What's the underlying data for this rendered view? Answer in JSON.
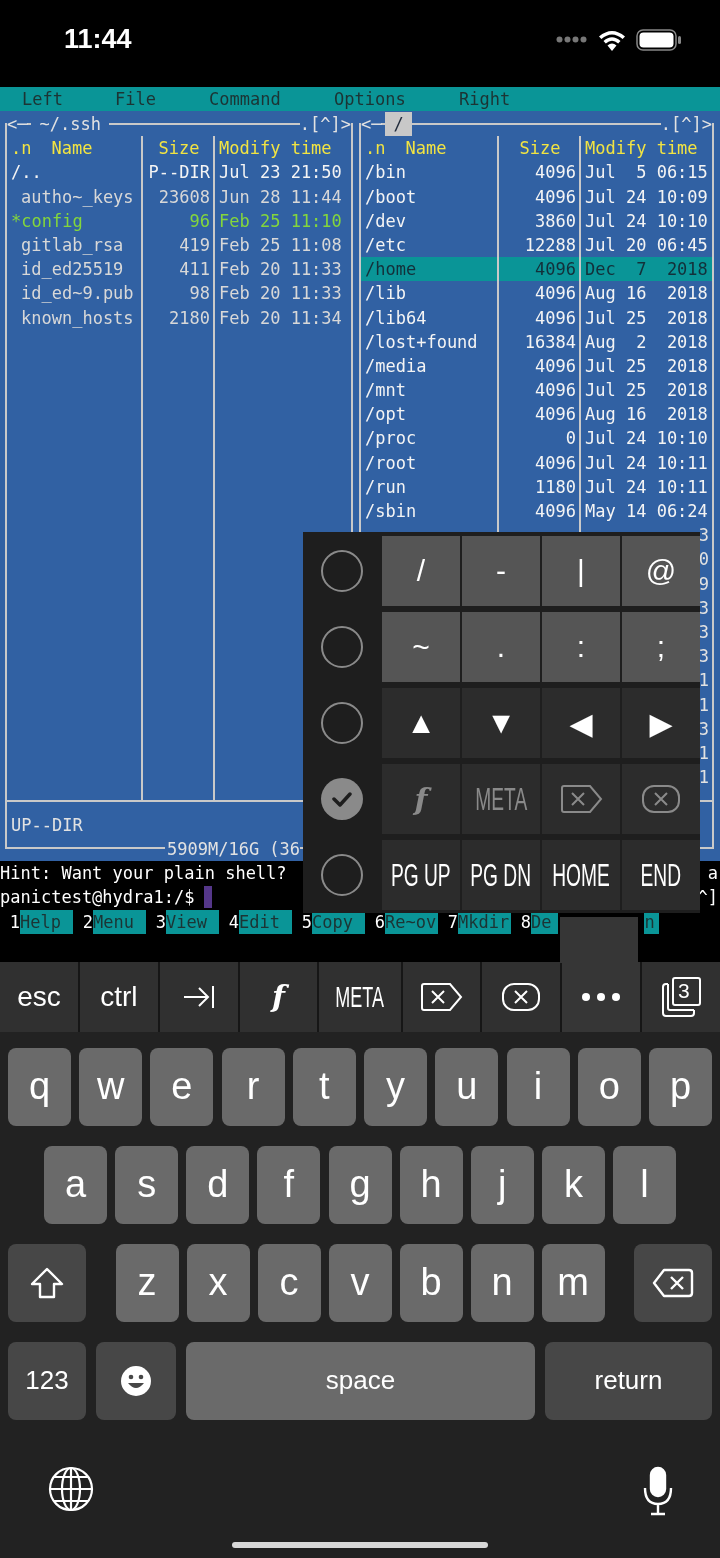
{
  "status_bar": {
    "time": "11:44"
  },
  "menu_bar": {
    "items": [
      "Left",
      "File",
      "Command",
      "Options",
      "Right"
    ]
  },
  "left_panel": {
    "title": {
      "prefix": "<─",
      "path": "~/.ssh",
      "active": false
    },
    "title_suffix": ".[^]>",
    "sort_mark": ".n",
    "columns": [
      "Name",
      "Size",
      "Modify time"
    ],
    "rows": [
      {
        "name": "/..",
        "size": "P--DIR",
        "time": "Jul 23 21:50",
        "kind": "dir",
        "selected": false
      },
      {
        "name": "autho~_keys",
        "size": "23608",
        "time": "Jun 28 11:44",
        "kind": "file",
        "selected": false
      },
      {
        "name": "*config",
        "size": "96",
        "time": "Feb 25 11:10",
        "kind": "executable",
        "selected": false
      },
      {
        "name": "gitlab_rsa",
        "size": "419",
        "time": "Feb 25 11:08",
        "kind": "file",
        "selected": false
      },
      {
        "name": "id_ed25519",
        "size": "411",
        "time": "Feb 20 11:33",
        "kind": "file",
        "selected": false
      },
      {
        "name": "id_ed~9.pub",
        "size": "98",
        "time": "Feb 20 11:33",
        "kind": "file",
        "selected": false
      },
      {
        "name": "known_hosts",
        "size": "2180",
        "time": "Feb 20 11:34",
        "kind": "file",
        "selected": false
      }
    ],
    "mini_status": "UP--DIR",
    "disk_info": "5909M/16G (36"
  },
  "right_panel": {
    "title": {
      "prefix": "<─",
      "path": "/",
      "active": true
    },
    "title_suffix": ".[^]>",
    "sort_mark": ".n",
    "columns": [
      "Name",
      "Size",
      "Modify time"
    ],
    "rows": [
      {
        "name": "/bin",
        "size": "4096",
        "time": "Jul  5 06:15",
        "kind": "dir",
        "selected": false
      },
      {
        "name": "/boot",
        "size": "4096",
        "time": "Jul 24 10:09",
        "kind": "dir",
        "selected": false
      },
      {
        "name": "/dev",
        "size": "3860",
        "time": "Jul 24 10:10",
        "kind": "dir",
        "selected": false
      },
      {
        "name": "/etc",
        "size": "12288",
        "time": "Jul 20 06:45",
        "kind": "dir",
        "selected": false
      },
      {
        "name": "/home",
        "size": "4096",
        "time": "Dec  7  2018",
        "kind": "dir",
        "selected": true
      },
      {
        "name": "/lib",
        "size": "4096",
        "time": "Aug 16  2018",
        "kind": "dir",
        "selected": false
      },
      {
        "name": "/lib64",
        "size": "4096",
        "time": "Jul 25  2018",
        "kind": "dir",
        "selected": false
      },
      {
        "name": "/lost+found",
        "size": "16384",
        "time": "Aug  2  2018",
        "kind": "dir",
        "selected": false
      },
      {
        "name": "/media",
        "size": "4096",
        "time": "Jul 25  2018",
        "kind": "dir",
        "selected": false
      },
      {
        "name": "/mnt",
        "size": "4096",
        "time": "Jul 25  2018",
        "kind": "dir",
        "selected": false
      },
      {
        "name": "/opt",
        "size": "4096",
        "time": "Aug 16  2018",
        "kind": "dir",
        "selected": false
      },
      {
        "name": "/proc",
        "size": "0",
        "time": "Jul 24 10:10",
        "kind": "dir",
        "selected": false
      },
      {
        "name": "/root",
        "size": "4096",
        "time": "Jul 24 10:11",
        "kind": "dir",
        "selected": false
      },
      {
        "name": "/run",
        "size": "1180",
        "time": "Jul 24 10:11",
        "kind": "dir",
        "selected": false
      },
      {
        "name": "/sbin",
        "size": "4096",
        "time": "May 14 06:24",
        "kind": "dir",
        "selected": false
      }
    ],
    "hidden_row_tails": [
      "3",
      "0",
      "9",
      "3",
      "3",
      "3",
      "1",
      "1",
      "3",
      "1",
      "1"
    ]
  },
  "hint": "Hint: Want your plain shell?",
  "hint_tail": "a",
  "prompt": "panictest@hydra1:/$",
  "prompt_tail": "^]",
  "function_keys": [
    {
      "number": "1",
      "label": "Help"
    },
    {
      "number": "2",
      "label": "Menu"
    },
    {
      "number": "3",
      "label": "View"
    },
    {
      "number": "4",
      "label": "Edit"
    },
    {
      "number": "5",
      "label": "Copy"
    },
    {
      "number": "6",
      "label": "Re~ov"
    },
    {
      "number": "7",
      "label": "Mkdir"
    },
    {
      "number": "8",
      "label": "De"
    }
  ],
  "function_key_tail": "n",
  "extra_keys_panel": {
    "rows": [
      {
        "selected": false,
        "kind": "symbols",
        "keys": [
          {
            "kind": "text",
            "label": "/"
          },
          {
            "kind": "text",
            "label": "-"
          },
          {
            "kind": "text",
            "label": "|"
          },
          {
            "kind": "text",
            "label": "@"
          }
        ]
      },
      {
        "selected": false,
        "kind": "symbols",
        "keys": [
          {
            "kind": "text",
            "label": "~"
          },
          {
            "kind": "text",
            "label": "."
          },
          {
            "kind": "text",
            "label": ":"
          },
          {
            "kind": "text",
            "label": ";"
          }
        ]
      },
      {
        "selected": false,
        "kind": "special",
        "keys": [
          {
            "kind": "text",
            "label": "▲"
          },
          {
            "kind": "text",
            "label": "▼"
          },
          {
            "kind": "text",
            "label": "◀"
          },
          {
            "kind": "text",
            "label": "▶"
          }
        ]
      },
      {
        "selected": true,
        "kind": "special",
        "keys": [
          {
            "kind": "function",
            "label": "f"
          },
          {
            "kind": "condensed",
            "label": "META"
          },
          {
            "kind": "forward-delete"
          },
          {
            "kind": "clear"
          }
        ]
      },
      {
        "selected": false,
        "kind": "special",
        "keys": [
          {
            "kind": "condensed",
            "label": "PG UP"
          },
          {
            "kind": "condensed",
            "label": "PG DN"
          },
          {
            "kind": "condensed",
            "label": "HOME"
          },
          {
            "kind": "condensed",
            "label": "END"
          }
        ]
      }
    ]
  },
  "accessory_bar": {
    "keys": [
      {
        "kind": "text",
        "label": "esc",
        "selected": false
      },
      {
        "kind": "text",
        "label": "ctrl",
        "selected": false
      },
      {
        "kind": "tab",
        "selected": false
      },
      {
        "kind": "function",
        "label": "f",
        "selected": false
      },
      {
        "kind": "condensed",
        "label": "META",
        "selected": false
      },
      {
        "kind": "forward-delete",
        "selected": false
      },
      {
        "kind": "clear",
        "selected": false
      },
      {
        "kind": "more",
        "selected": true
      },
      {
        "kind": "sessions",
        "label": "3",
        "selected": false
      }
    ]
  },
  "keyboard": {
    "rows": [
      {
        "keys": [
          {
            "kind": "letter",
            "label": "q"
          },
          {
            "kind": "letter",
            "label": "w"
          },
          {
            "kind": "letter",
            "label": "e"
          },
          {
            "kind": "letter",
            "label": "r"
          },
          {
            "kind": "letter",
            "label": "t"
          },
          {
            "kind": "letter",
            "label": "y"
          },
          {
            "kind": "letter",
            "label": "u"
          },
          {
            "kind": "letter",
            "label": "i"
          },
          {
            "kind": "letter",
            "label": "o"
          },
          {
            "kind": "letter",
            "label": "p"
          }
        ]
      },
      {
        "keys": [
          {
            "kind": "letter",
            "label": "a"
          },
          {
            "kind": "letter",
            "label": "s"
          },
          {
            "kind": "letter",
            "label": "d"
          },
          {
            "kind": "letter",
            "label": "f"
          },
          {
            "kind": "letter",
            "label": "g"
          },
          {
            "kind": "letter",
            "label": "h"
          },
          {
            "kind": "letter",
            "label": "j"
          },
          {
            "kind": "letter",
            "label": "k"
          },
          {
            "kind": "letter",
            "label": "l"
          }
        ]
      },
      {
        "keys": [
          {
            "kind": "shift"
          },
          {
            "kind": "letter",
            "label": "z"
          },
          {
            "kind": "letter",
            "label": "x"
          },
          {
            "kind": "letter",
            "label": "c"
          },
          {
            "kind": "letter",
            "label": "v"
          },
          {
            "kind": "letter",
            "label": "b"
          },
          {
            "kind": "letter",
            "label": "n"
          },
          {
            "kind": "letter",
            "label": "m"
          },
          {
            "kind": "backspace"
          }
        ]
      },
      {
        "keys": [
          {
            "kind": "numbers",
            "label": "123"
          },
          {
            "kind": "emoji"
          },
          {
            "kind": "space",
            "label": "space"
          },
          {
            "kind": "return",
            "label": "return"
          }
        ]
      }
    ]
  }
}
